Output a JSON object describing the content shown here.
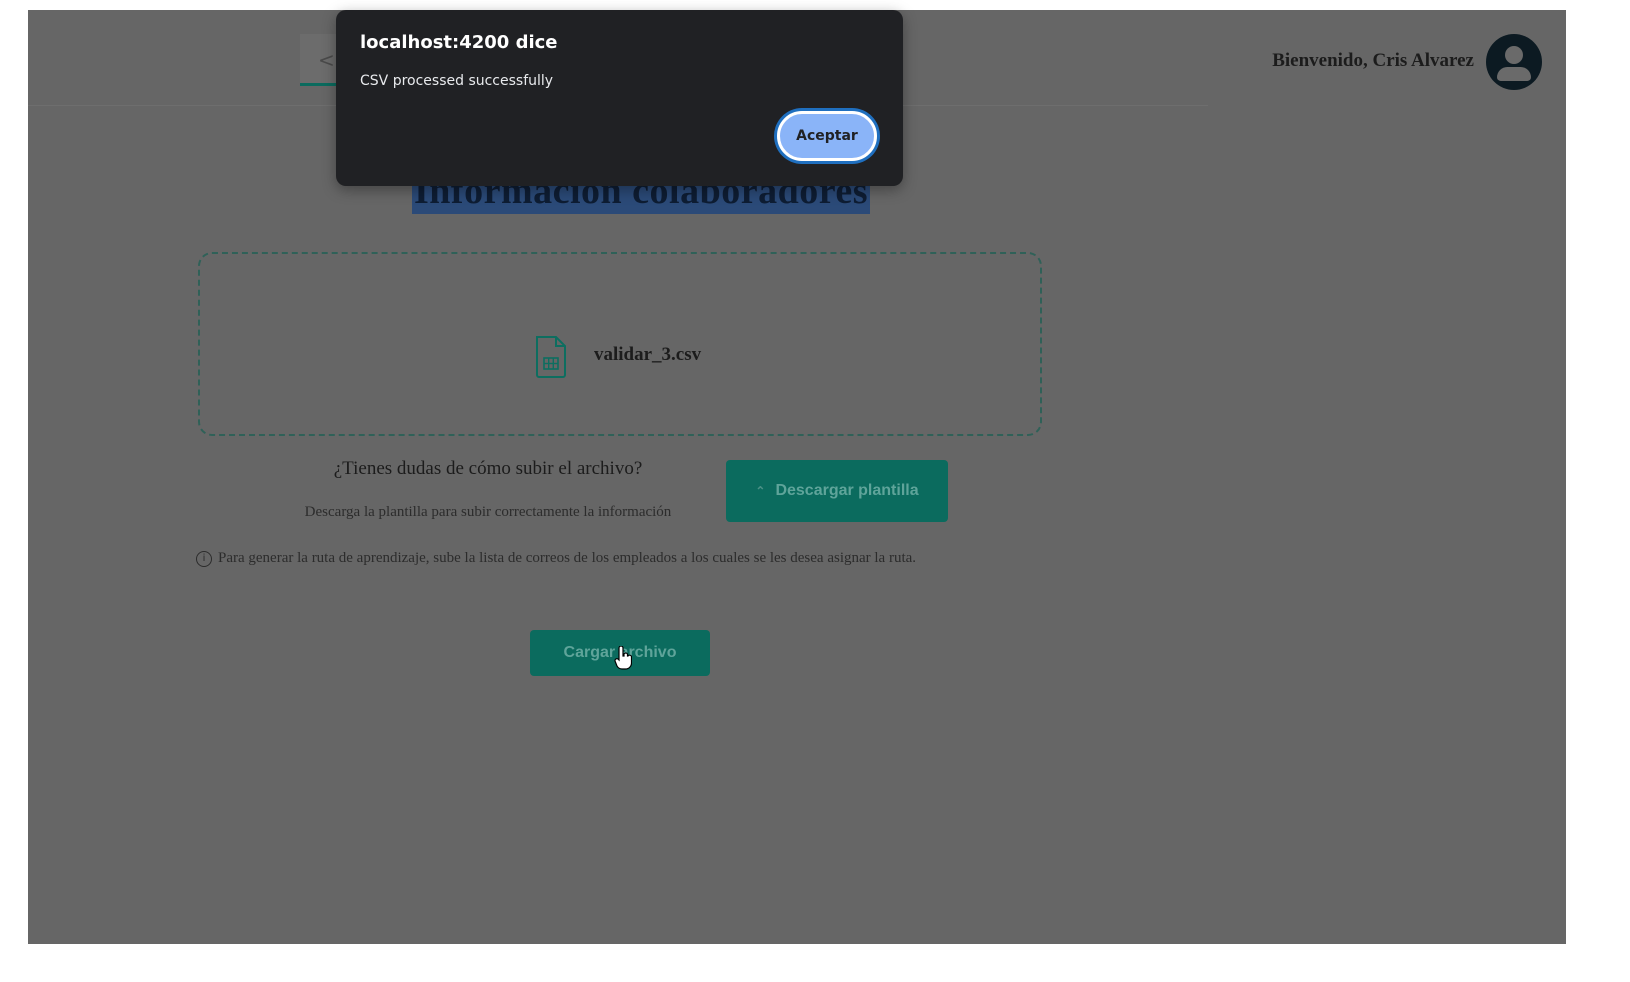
{
  "header": {
    "back_glyph": "<",
    "welcome_text": "Bienvenido, Cris Alvarez"
  },
  "main": {
    "title": "Información colaboradores",
    "file_name": "validar_3.csv",
    "help_question": "¿Tienes dudas de cómo subir el archivo?",
    "help_subtitle": "Descarga la plantilla para subir correctamente la información",
    "download_label": "Descargar plantilla",
    "info_text": "Para generar la ruta de aprendizaje, sube la lista de correos de los empleados a los cuales se les desea asignar la ruta.",
    "upload_label": "Cargar archivo"
  },
  "dialog": {
    "title": "localhost:4200 dice",
    "message": "CSV processed successfully",
    "accept_label": "Aceptar"
  },
  "icons": {
    "file": "csv-file-icon",
    "avatar": "user-avatar-icon",
    "info": "info-icon",
    "download": "download-icon",
    "back": "chevron-left-icon",
    "cursor": "hand-pointer-icon"
  },
  "colors": {
    "overlay": "#666666",
    "accent": "#0b6b5e",
    "dialog_bg": "#202124",
    "dialog_button": "#8ab4f8"
  }
}
